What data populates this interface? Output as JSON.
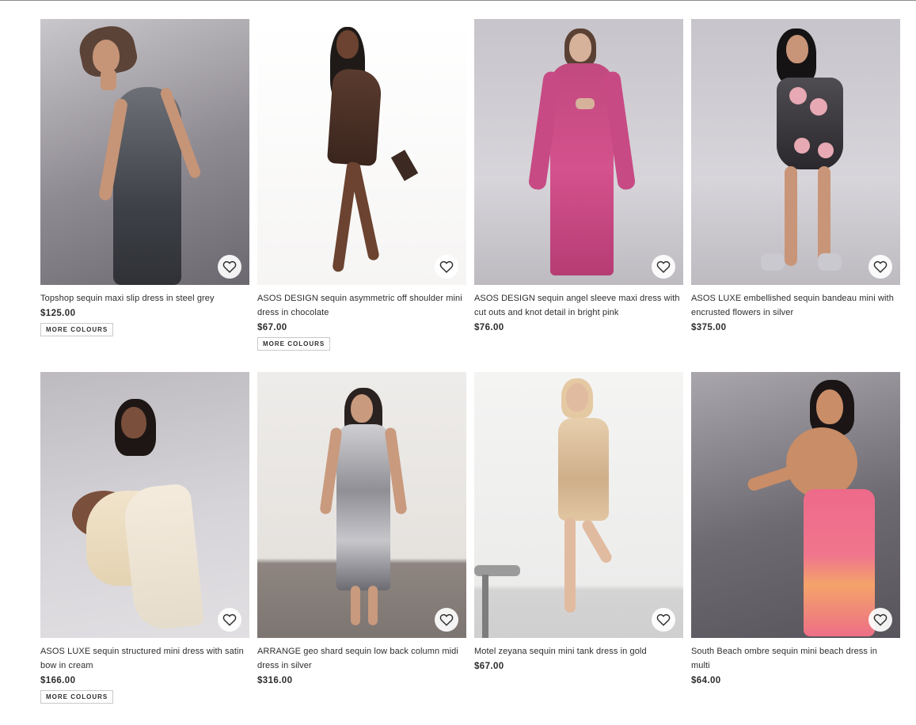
{
  "products": [
    {
      "title": "Topshop sequin maxi slip dress in steel grey",
      "price": "$125.00",
      "more_colours": "MORE COLOURS"
    },
    {
      "title": "ASOS DESIGN sequin asymmetric off shoulder mini dress in chocolate",
      "price": "$67.00",
      "more_colours": "MORE COLOURS"
    },
    {
      "title": "ASOS DESIGN sequin angel sleeve maxi dress with cut outs and knot detail in bright pink",
      "price": "$76.00",
      "more_colours": ""
    },
    {
      "title": "ASOS LUXE embellished sequin bandeau mini with encrusted flowers in silver",
      "price": "$375.00",
      "more_colours": ""
    },
    {
      "title": "ASOS LUXE sequin structured mini dress with satin bow in cream",
      "price": "$166.00",
      "more_colours": "MORE COLOURS"
    },
    {
      "title": "ARRANGE geo shard sequin low back column midi dress in silver",
      "price": "$316.00",
      "more_colours": ""
    },
    {
      "title": "Motel zeyana sequin mini tank dress in gold",
      "price": "$67.00",
      "more_colours": ""
    },
    {
      "title": "South Beach ombre sequin mini beach dress in multi",
      "price": "$64.00",
      "more_colours": ""
    }
  ],
  "icons": {
    "wishlist": "heart-icon"
  },
  "colors": {
    "text": "#2d2d2d",
    "border": "#c9c9c9",
    "background": "#ffffff"
  }
}
